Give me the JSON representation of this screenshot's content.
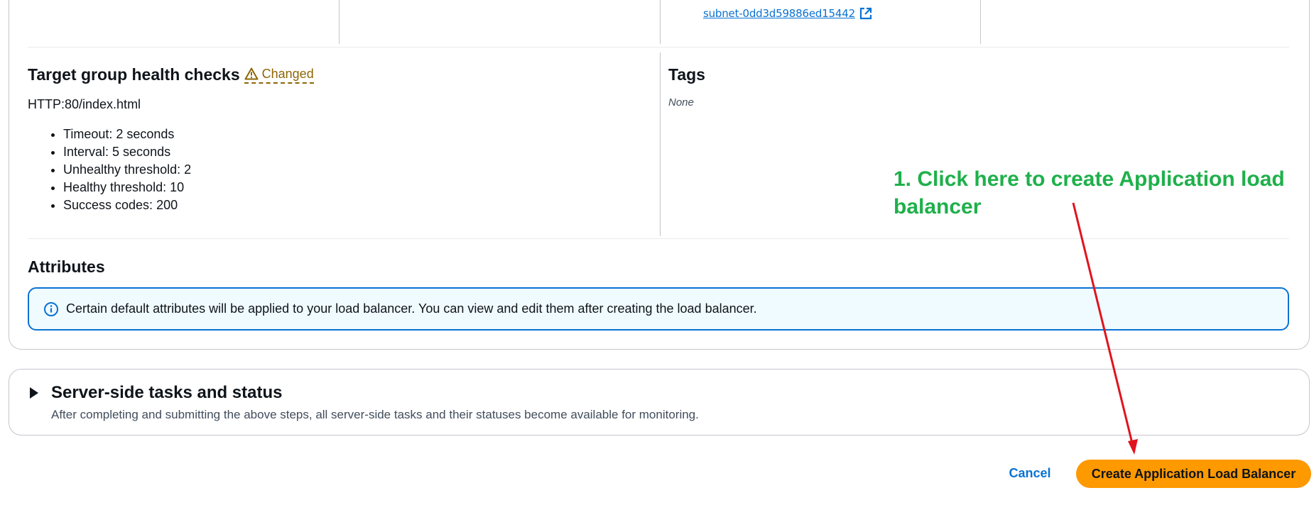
{
  "network": {
    "subnet_link": "subnet-0dd3d59886ed15442",
    "external_icon": "external-link-icon"
  },
  "health_checks": {
    "title": "Target group health checks",
    "changed_label": "Changed",
    "changed_icon": "warning-icon",
    "path": "HTTP:80/index.html",
    "items": [
      "Timeout: 2 seconds",
      "Interval: 5 seconds",
      "Unhealthy threshold: 2",
      "Healthy threshold: 10",
      "Success codes: 200"
    ]
  },
  "tags": {
    "title": "Tags",
    "value": "None"
  },
  "attributes": {
    "title": "Attributes",
    "info_icon": "info-icon",
    "info_text": "Certain default attributes will be applied to your load balancer. You can view and edit them after creating the load balancer."
  },
  "server_tasks": {
    "title": "Server-side tasks and status",
    "description": "After completing and submitting the above steps, all server-side tasks and their statuses become available for monitoring."
  },
  "actions": {
    "cancel_label": "Cancel",
    "create_label": "Create Application Load Balancer"
  },
  "annotation": {
    "text": "1. Click here to create Application load balancer",
    "color": "#1fb04b",
    "arrow_color": "#e0141e"
  },
  "colors": {
    "link": "#0972d3",
    "primary_button": "#ff9900",
    "warning": "#8d6605",
    "info_border": "#0972d3",
    "info_background": "#f0fbff"
  }
}
